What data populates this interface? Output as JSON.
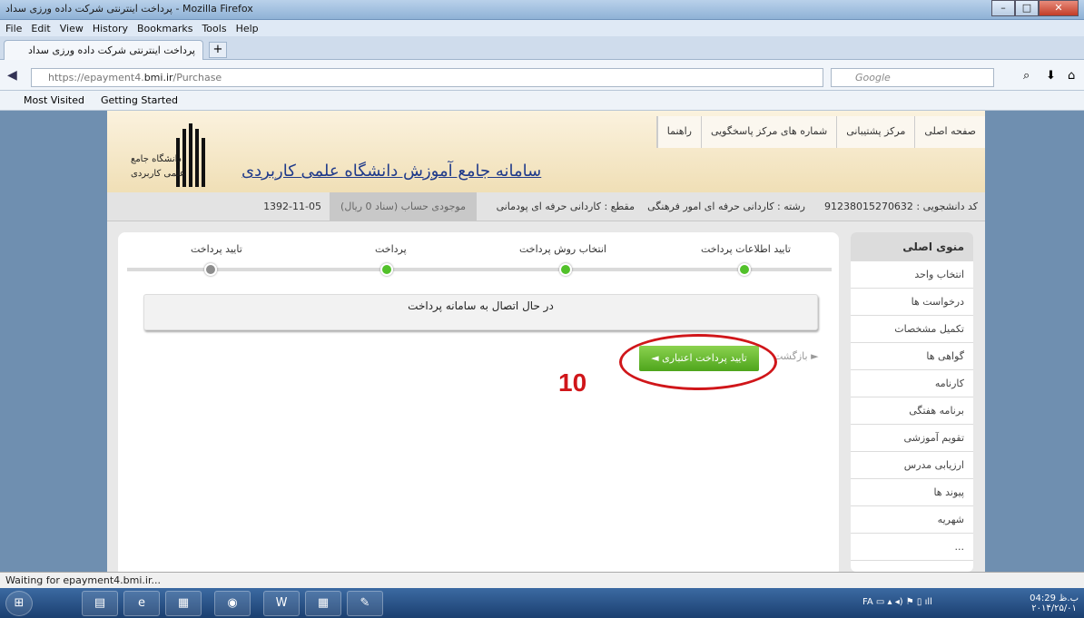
{
  "window": {
    "title": "پرداخت اینترنتی شرکت داده ورزی سداد - Mozilla Firefox"
  },
  "menu": [
    "File",
    "Edit",
    "View",
    "History",
    "Bookmarks",
    "Tools",
    "Help"
  ],
  "tab": {
    "label": "پرداخت اینترنتی شرکت داده ورزی سداد"
  },
  "address": {
    "prefix": "https://epayment4.",
    "domain": "bmi.ir",
    "path": "/Purchase"
  },
  "search": {
    "placeholder": "Google"
  },
  "bookmarks": [
    "Most Visited",
    "Getting Started"
  ],
  "site": {
    "title": "سامانه جامع آموزش دانشگاه علمی کاربردی",
    "logo_text": "دانشگاه جامع علمی کاربردی"
  },
  "topnav": [
    "صفحه اصلی",
    "مرکز پشتیبانی",
    "شماره های مرکز پاسخگویی",
    "راهنما"
  ],
  "info": {
    "student_code": "کد دانشجویی : 91238015270632",
    "field": "رشته : کاردانی حرفه ای امور فرهنگی",
    "level": "مقطع : کاردانی حرفه ای پودمانی",
    "balance": "موجودی حساب (سناد 0 ریال)",
    "date": "1392-11-05"
  },
  "steps": [
    "تایید اطلاعات پرداخت",
    "انتخاب روش پرداخت",
    "پرداخت",
    "تایید پرداخت"
  ],
  "connect_message": "در حال اتصال به سامانه پرداخت",
  "confirm_button": "تایید پرداخت اعتباری ◄",
  "back_link": "► بازگشت",
  "counter": "10",
  "sidebar": {
    "title": "منوی اصلی",
    "items": [
      "انتخاب واحد",
      "درخواست ها",
      "تکمیل مشخصات",
      "گواهی ها",
      "کارنامه",
      "برنامه هفتگی",
      "تقویم آموزشی",
      "ارزیابی مدرس",
      "پیوند ها",
      "شهریه",
      "..."
    ]
  },
  "status": "Waiting for epayment4.bmi.ir...",
  "clock": {
    "time": "04:29 ب.ظ",
    "date": "۲۰۱۴/۲۵/۰۱"
  },
  "tray": {
    "lang": "FA"
  },
  "accent_green": "#52c12a",
  "annotation_red": "#d0161a"
}
